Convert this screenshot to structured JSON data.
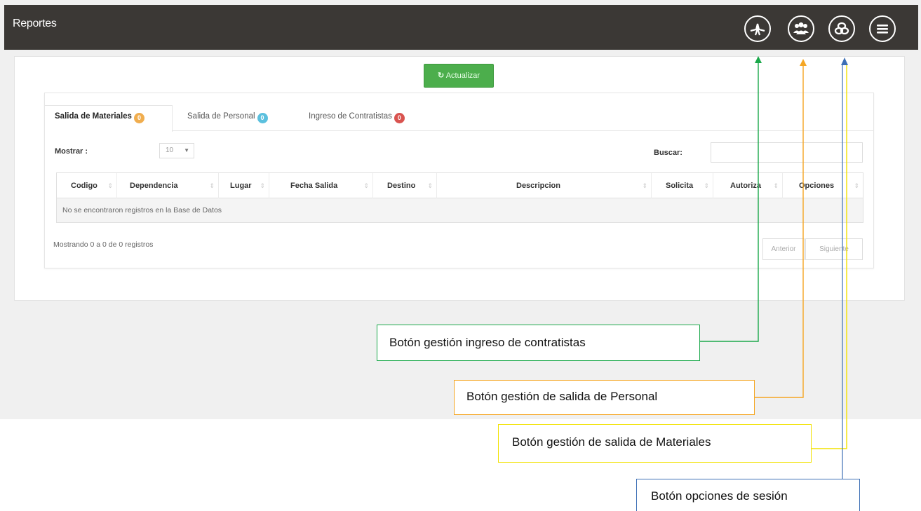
{
  "app": {
    "title": "Reportes"
  },
  "header": {
    "icons": [
      {
        "name": "contractors-entry-icon"
      },
      {
        "name": "personnel-group-icon"
      },
      {
        "name": "materials-icon"
      },
      {
        "name": "menu-icon"
      }
    ]
  },
  "toolbar": {
    "refresh_icon": "↻",
    "refresh_label": "Actualizar"
  },
  "tabs": [
    {
      "label": "Salida de Materiales",
      "badge": "0",
      "badge_color": "#f0ad4e",
      "active": true
    },
    {
      "label": "Salida de Personal",
      "badge": "0",
      "badge_color": "#5bc0de",
      "active": false
    },
    {
      "label": "Ingreso de Contratistas",
      "badge": "0",
      "badge_color": "#d9534f",
      "active": false
    }
  ],
  "controls": {
    "show_label": "Mostrar :",
    "page_size": "10",
    "search_label": "Buscar:",
    "search_value": ""
  },
  "table": {
    "columns": [
      "Codigo",
      "Dependencia",
      "Lugar",
      "Fecha Salida",
      "Destino",
      "Descripcion",
      "Solicita",
      "Autoriza",
      "Opciones"
    ],
    "empty_message": "No se encontraron registros en la Base de Datos"
  },
  "footer": {
    "info": "Mostrando 0 a 0 de 0 registros",
    "prev_label": "Anterior",
    "next_label": "Siguiente"
  },
  "callouts": {
    "contractors": "Botón gestión  ingreso de contratistas",
    "personnel": "Botón gestión de salida de Personal",
    "materials": "Botón gestión de salida de Materiales",
    "session": "Botón opciones de sesión"
  },
  "colors": {
    "topbar": "#3b3835",
    "refresh_button": "#4cae4c",
    "callout_green": "#1aa84a",
    "callout_orange": "#f5a623",
    "callout_yellow": "#f2e200",
    "callout_blue": "#3d6fb5"
  }
}
